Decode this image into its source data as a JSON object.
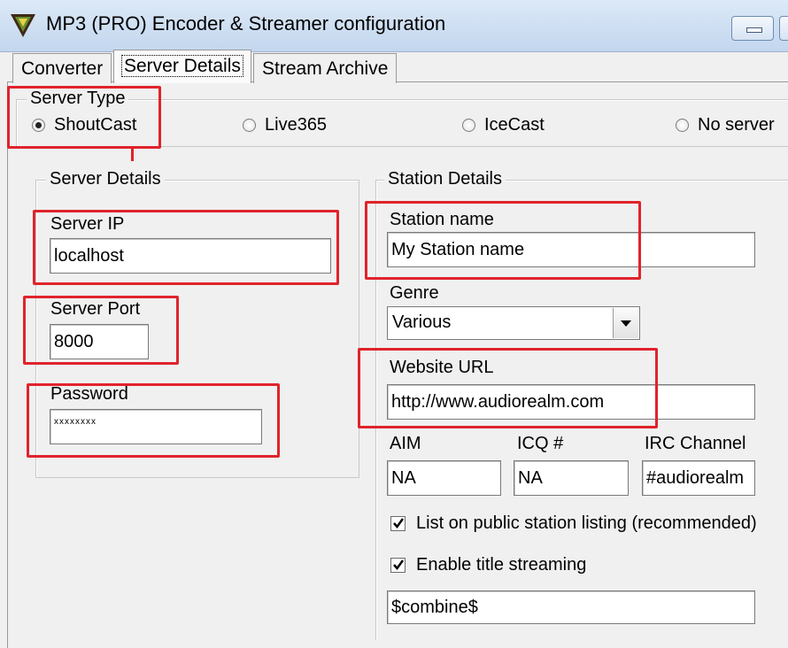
{
  "window": {
    "title": "MP3 (PRO) Encoder & Streamer configuration"
  },
  "tabs": [
    {
      "label": "Converter",
      "active": false
    },
    {
      "label": "Server Details",
      "active": true
    },
    {
      "label": "Stream Archive",
      "active": false
    }
  ],
  "server_type": {
    "legend": "Server Type",
    "options": [
      {
        "label": "ShoutCast",
        "selected": true
      },
      {
        "label": "Live365",
        "selected": false
      },
      {
        "label": "IceCast",
        "selected": false
      },
      {
        "label": "No server",
        "selected": false
      }
    ]
  },
  "server_details": {
    "legend": "Server Details",
    "ip_label": "Server IP",
    "ip_value": "localhost",
    "port_label": "Server Port",
    "port_value": "8000",
    "password_label": "Password",
    "password_value": "xxxxxxxx"
  },
  "station_details": {
    "legend": "Station Details",
    "name_label": "Station name",
    "name_value": "My Station name",
    "genre_label": "Genre",
    "genre_value": "Various",
    "url_label": "Website URL",
    "url_value": "http://www.audiorealm.com",
    "aim_label": "AIM",
    "aim_value": "NA",
    "icq_label": "ICQ #",
    "icq_value": "NA",
    "irc_label": "IRC Channel",
    "irc_value": "#audiorealm",
    "list_public_label": "List on public station listing (recommended)",
    "list_public_checked": true,
    "title_streaming_label": "Enable title streaming",
    "title_streaming_checked": true,
    "title_format_value": "$combine$"
  },
  "colors": {
    "highlight": "#e0232b",
    "titlebar": "#c3d6ee",
    "panel": "#f0f0f0"
  }
}
